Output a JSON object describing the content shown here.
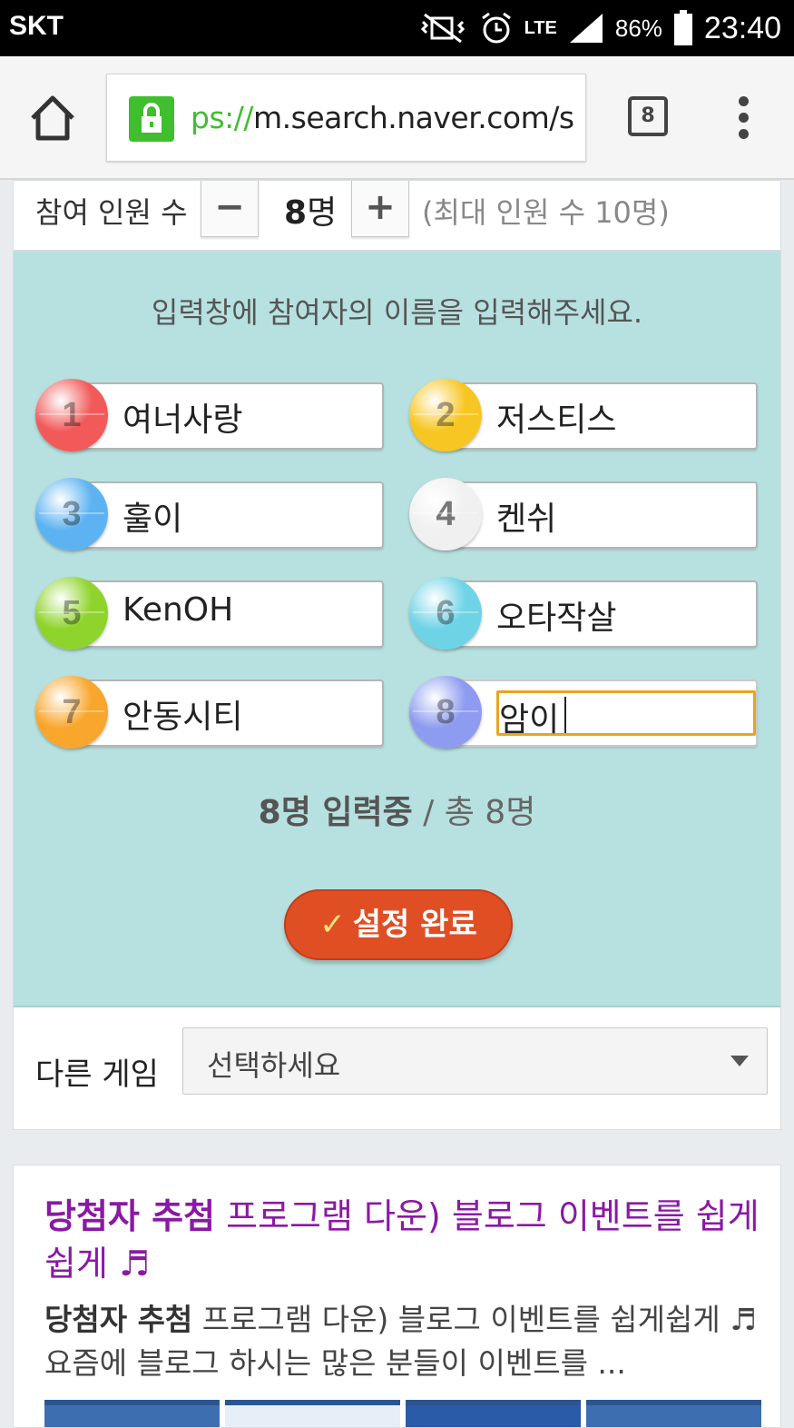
{
  "status_bar": {
    "carrier": "SKT",
    "network": "LTE",
    "battery": "86%",
    "time": "23:40"
  },
  "browser": {
    "url_scheme": "ps://",
    "url_rest": "m.search.naver.com/s",
    "tab_count": "8"
  },
  "game": {
    "participant_label": "참여 인원 수",
    "minus": "−",
    "plus": "+",
    "count": "8",
    "count_unit": "명",
    "max_note": "(최대 인원 수 10명)",
    "instruction": "입력창에 참여자의 이름을 입력해주세요.",
    "players": [
      {
        "number": "1",
        "name": "여너사랑",
        "color": "#f25a5a"
      },
      {
        "number": "2",
        "name": "저스티스",
        "color": "#f7c623"
      },
      {
        "number": "3",
        "name": "훌이",
        "color": "#5db3f2"
      },
      {
        "number": "4",
        "name": "켄쉬",
        "color": "#f0f0f0"
      },
      {
        "number": "5",
        "name": "KenOH",
        "color": "#8fd42c"
      },
      {
        "number": "6",
        "name": "오타작살",
        "color": "#6fd3e6"
      },
      {
        "number": "7",
        "name": "안동시티",
        "color": "#f9a62c"
      },
      {
        "number": "8",
        "name": "암이",
        "color": "#8d9cf0"
      }
    ],
    "progress_count": "8명 입력중",
    "progress_total": "/ 총 8명",
    "done_label": "설정 완료",
    "other_game_label": "다른 게임",
    "other_game_select": "선택하세요"
  },
  "result": {
    "title_bold": "당첨자 추첨",
    "title_rest": " 프로그램 다운) 블로그 이벤트를 쉽게쉽게 ♬",
    "desc_bold": "당첨자 추첨",
    "desc_rest": " 프로그램 다운) 블로그 이벤트를 쉽게쉽게 ♬ 요즘에 블로그 하시는 많은 분들이 이벤트를 ..."
  }
}
